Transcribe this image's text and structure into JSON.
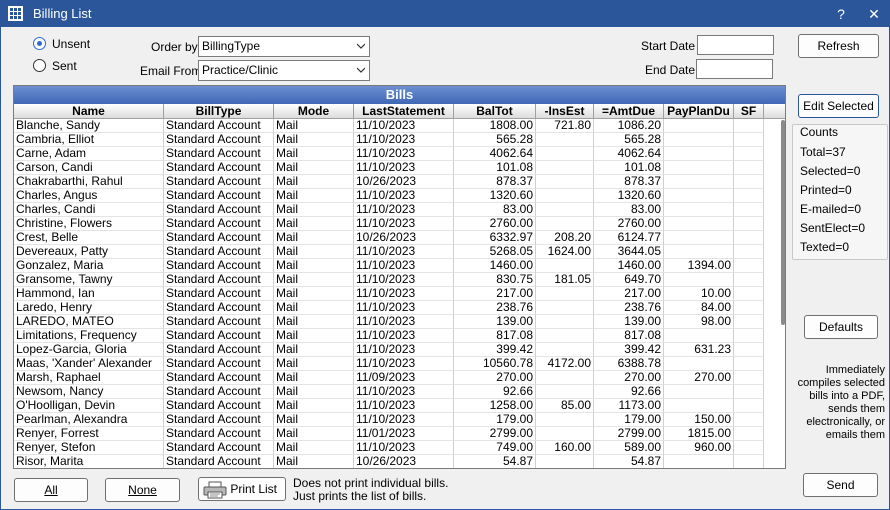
{
  "window": {
    "title": "Billing List",
    "help_label": "?",
    "close_label": "✕"
  },
  "options": {
    "unsent_label": "Unsent",
    "sent_label": "Sent",
    "unsent_selected": true,
    "order_by_label": "Order by",
    "order_by_value": "BillingType",
    "email_from_label": "Email From",
    "email_from_value": "Practice/Clinic",
    "start_date_label": "Start Date",
    "start_date_value": "",
    "end_date_label": "End Date",
    "end_date_value": ""
  },
  "buttons": {
    "refresh": "Refresh",
    "edit_selected": "Edit Selected",
    "defaults": "Defaults",
    "send": "Send",
    "all": "All",
    "none": "None",
    "print_list": "Print List"
  },
  "print_note": [
    "Does not print individual bills.",
    "Just prints the list of bills."
  ],
  "send_note": [
    "Immediately",
    "compiles selected",
    "bills into a PDF,",
    "sends them",
    "electronically, or",
    "emails them"
  ],
  "counts": {
    "title": "Counts",
    "lines": [
      "Total=37",
      "Selected=0",
      "Printed=0",
      "E-mailed=0",
      "SentElect=0",
      "Texted=0"
    ]
  },
  "grid": {
    "title": "Bills",
    "columns": [
      "Name",
      "BillType",
      "Mode",
      "LastStatement",
      "BalTot",
      "-InsEst",
      "=AmtDue",
      "PayPlanDu",
      "SF"
    ],
    "rows": [
      [
        "Blanche, Sandy",
        "Standard Account",
        "Mail",
        "11/10/2023",
        "1808.00",
        "721.80",
        "1086.20",
        "",
        ""
      ],
      [
        "Cambria, Elliot",
        "Standard Account",
        "Mail",
        "11/10/2023",
        "565.28",
        "",
        "565.28",
        "",
        ""
      ],
      [
        "Carne, Adam",
        "Standard Account",
        "Mail",
        "11/10/2023",
        "4062.64",
        "",
        "4062.64",
        "",
        ""
      ],
      [
        "Carson, Candi",
        "Standard Account",
        "Mail",
        "11/10/2023",
        "101.08",
        "",
        "101.08",
        "",
        ""
      ],
      [
        "Chakrabarthi, Rahul",
        "Standard Account",
        "Mail",
        "10/26/2023",
        "878.37",
        "",
        "878.37",
        "",
        ""
      ],
      [
        "Charles, Angus",
        "Standard Account",
        "Mail",
        "11/10/2023",
        "1320.60",
        "",
        "1320.60",
        "",
        ""
      ],
      [
        "Charles, Candi",
        "Standard Account",
        "Mail",
        "11/10/2023",
        "83.00",
        "",
        "83.00",
        "",
        ""
      ],
      [
        "Christine, Flowers",
        "Standard Account",
        "Mail",
        "11/10/2023",
        "2760.00",
        "",
        "2760.00",
        "",
        ""
      ],
      [
        "Crest, Belle",
        "Standard Account",
        "Mail",
        "10/26/2023",
        "6332.97",
        "208.20",
        "6124.77",
        "",
        ""
      ],
      [
        "Devereaux, Patty",
        "Standard Account",
        "Mail",
        "11/10/2023",
        "5268.05",
        "1624.00",
        "3644.05",
        "",
        ""
      ],
      [
        "Gonzalez, Maria",
        "Standard Account",
        "Mail",
        "11/10/2023",
        "1460.00",
        "",
        "1460.00",
        "1394.00",
        ""
      ],
      [
        "Gransome, Tawny",
        "Standard Account",
        "Mail",
        "11/10/2023",
        "830.75",
        "181.05",
        "649.70",
        "",
        ""
      ],
      [
        "Hammond, Ian",
        "Standard Account",
        "Mail",
        "11/10/2023",
        "217.00",
        "",
        "217.00",
        "10.00",
        ""
      ],
      [
        "Laredo, Henry",
        "Standard Account",
        "Mail",
        "11/10/2023",
        "238.76",
        "",
        "238.76",
        "84.00",
        ""
      ],
      [
        "LAREDO, MATEO",
        "Standard Account",
        "Mail",
        "11/10/2023",
        "139.00",
        "",
        "139.00",
        "98.00",
        ""
      ],
      [
        "Limitations, Frequency",
        "Standard Account",
        "Mail",
        "11/10/2023",
        "817.08",
        "",
        "817.08",
        "",
        ""
      ],
      [
        "Lopez-Garcia, Gloria",
        "Standard Account",
        "Mail",
        "11/10/2023",
        "399.42",
        "",
        "399.42",
        "631.23",
        ""
      ],
      [
        "Maas, 'Xander' Alexander",
        "Standard Account",
        "Mail",
        "11/10/2023",
        "10560.78",
        "4172.00",
        "6388.78",
        "",
        ""
      ],
      [
        "Marsh, Raphael",
        "Standard Account",
        "Mail",
        "11/09/2023",
        "270.00",
        "",
        "270.00",
        "270.00",
        ""
      ],
      [
        "Newsom, Nancy",
        "Standard Account",
        "Mail",
        "11/10/2023",
        "92.66",
        "",
        "92.66",
        "",
        ""
      ],
      [
        "O'Hoolligan, Devin",
        "Standard Account",
        "Mail",
        "11/10/2023",
        "1258.00",
        "85.00",
        "1173.00",
        "",
        ""
      ],
      [
        "Pearlman, Alexandra",
        "Standard Account",
        "Mail",
        "11/10/2023",
        "179.00",
        "",
        "179.00",
        "150.00",
        ""
      ],
      [
        "Renyer, Forrest",
        "Standard Account",
        "Mail",
        "11/01/2023",
        "2799.00",
        "",
        "2799.00",
        "1815.00",
        ""
      ],
      [
        "Renyer, Stefon",
        "Standard Account",
        "Mail",
        "11/10/2023",
        "749.00",
        "160.00",
        "589.00",
        "960.00",
        ""
      ],
      [
        "Risor, Marita",
        "Standard Account",
        "Mail",
        "10/26/2023",
        "54.87",
        "",
        "54.87",
        "",
        ""
      ]
    ]
  }
}
